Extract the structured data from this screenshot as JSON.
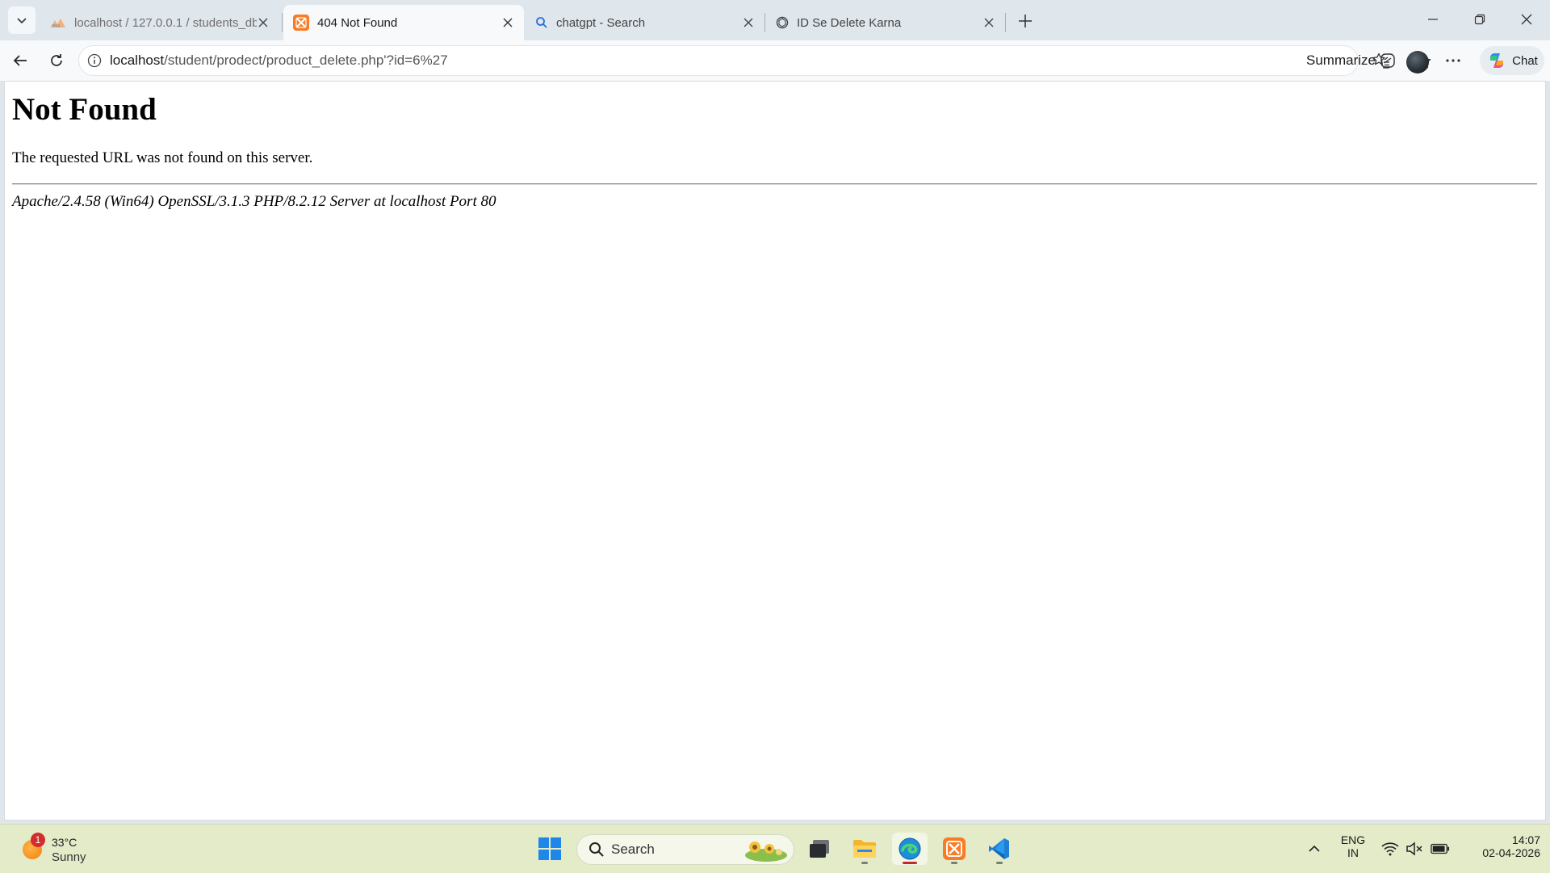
{
  "browser": {
    "tabs": [
      {
        "title": "localhost / 127.0.0.1 / students_db",
        "icon": "phpmyadmin-icon",
        "active": false
      },
      {
        "title": "404 Not Found",
        "icon": "xampp-icon",
        "active": true
      },
      {
        "title": "chatgpt - Search",
        "icon": "search-icon",
        "active": false
      },
      {
        "title": "ID Se Delete Karna",
        "icon": "chatgpt-icon",
        "active": false
      }
    ],
    "address": {
      "host": "localhost",
      "path": "/student/prodect/product_delete.php'?id=6%27"
    },
    "summarize_label": "Summarize",
    "chat_label": "Chat",
    "accent_color": "#0078d4"
  },
  "page": {
    "heading": "Not Found",
    "message": "The requested URL was not found on this server.",
    "server_signature": "Apache/2.4.58 (Win64) OpenSSL/3.1.3 PHP/8.2.12 Server at localhost Port 80"
  },
  "taskbar": {
    "weather": {
      "badge": "1",
      "temperature": "33°C",
      "condition": "Sunny"
    },
    "search_label": "Search",
    "language": {
      "line1": "ENG",
      "line2": "IN"
    },
    "clock": {
      "time": "14:07",
      "date": "02-04-2026"
    }
  }
}
